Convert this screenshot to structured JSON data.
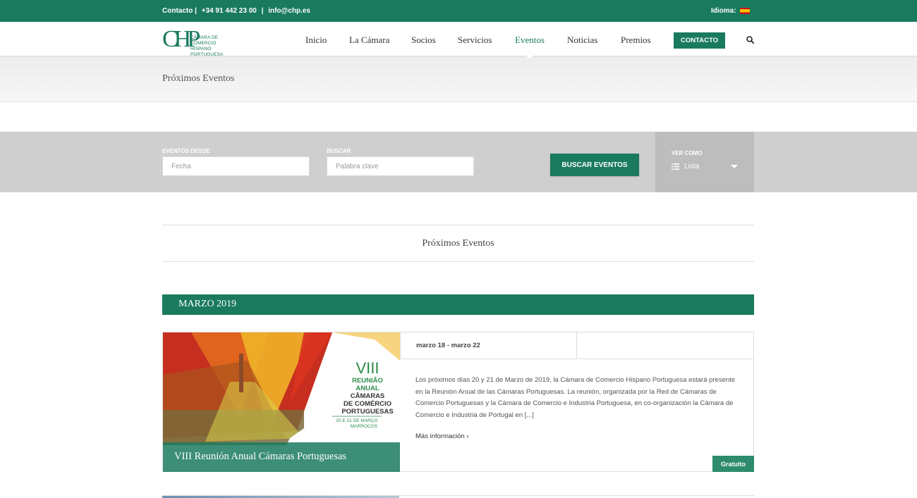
{
  "topbar": {
    "contact_label": "Contacto |",
    "phone": "+34 91 442 23 00",
    "separator": "|",
    "email": "info@chp.es",
    "language_label": "Idioma:"
  },
  "header": {
    "logo_mark": "CHP",
    "logo_line1": "CÂMARA DE COMERCIO",
    "logo_line2": "HISPANO PORTUGUESA",
    "nav": {
      "inicio": "Inicio",
      "la_camara": "La Cámara",
      "socios": "Socios",
      "servicios": "Servicios",
      "eventos": "Eventos",
      "noticias": "Noticias",
      "premios": "Premios"
    },
    "contact_button": "CONTACTO"
  },
  "page_title": "Próximos Eventos",
  "filters": {
    "from_label": "EVENTOS DESDE",
    "from_placeholder": "Fecha",
    "search_label": "BUSCAR",
    "search_placeholder": "Palabra clave",
    "search_button": "BUSCAR EVENTOS",
    "view_label": "VER COMO",
    "view_value": "Lista"
  },
  "section_title": "Próximos Eventos",
  "month": "MARZO 2019",
  "event": {
    "title": "VIII Reunión Anual Cámaras Portuguesas",
    "date": "marzo 18 - marzo 22",
    "description": "Los próximos días 20 y 21 de Marzo de 2019, la Cámara de Comercio Hispano Portuguesa estará presente en la Reunión Anual de las Cámaras Portuguesas. La reunión, organizada por la Red de Cámaras de Comercio Portuguesas y la Cámara de Comercio e Industria Portuguesa, en co-organización la Cámara de Comercio e Industria de Portugal en [...]",
    "more": "Más información",
    "badge": "Gratuito",
    "poster": {
      "numeral": "VIII",
      "line1": "REUNIÃO",
      "line2": "ANUAL",
      "line3": "CÂMARAS",
      "line4": "DE COMÉRCIO",
      "line5": "PORTUGUESAS",
      "dates": "20 E 21 DE MARÇO",
      "place": "MARROCOS"
    }
  },
  "colors": {
    "brand": "#1a7a5e",
    "filter_bg": "#cfcfcf"
  }
}
